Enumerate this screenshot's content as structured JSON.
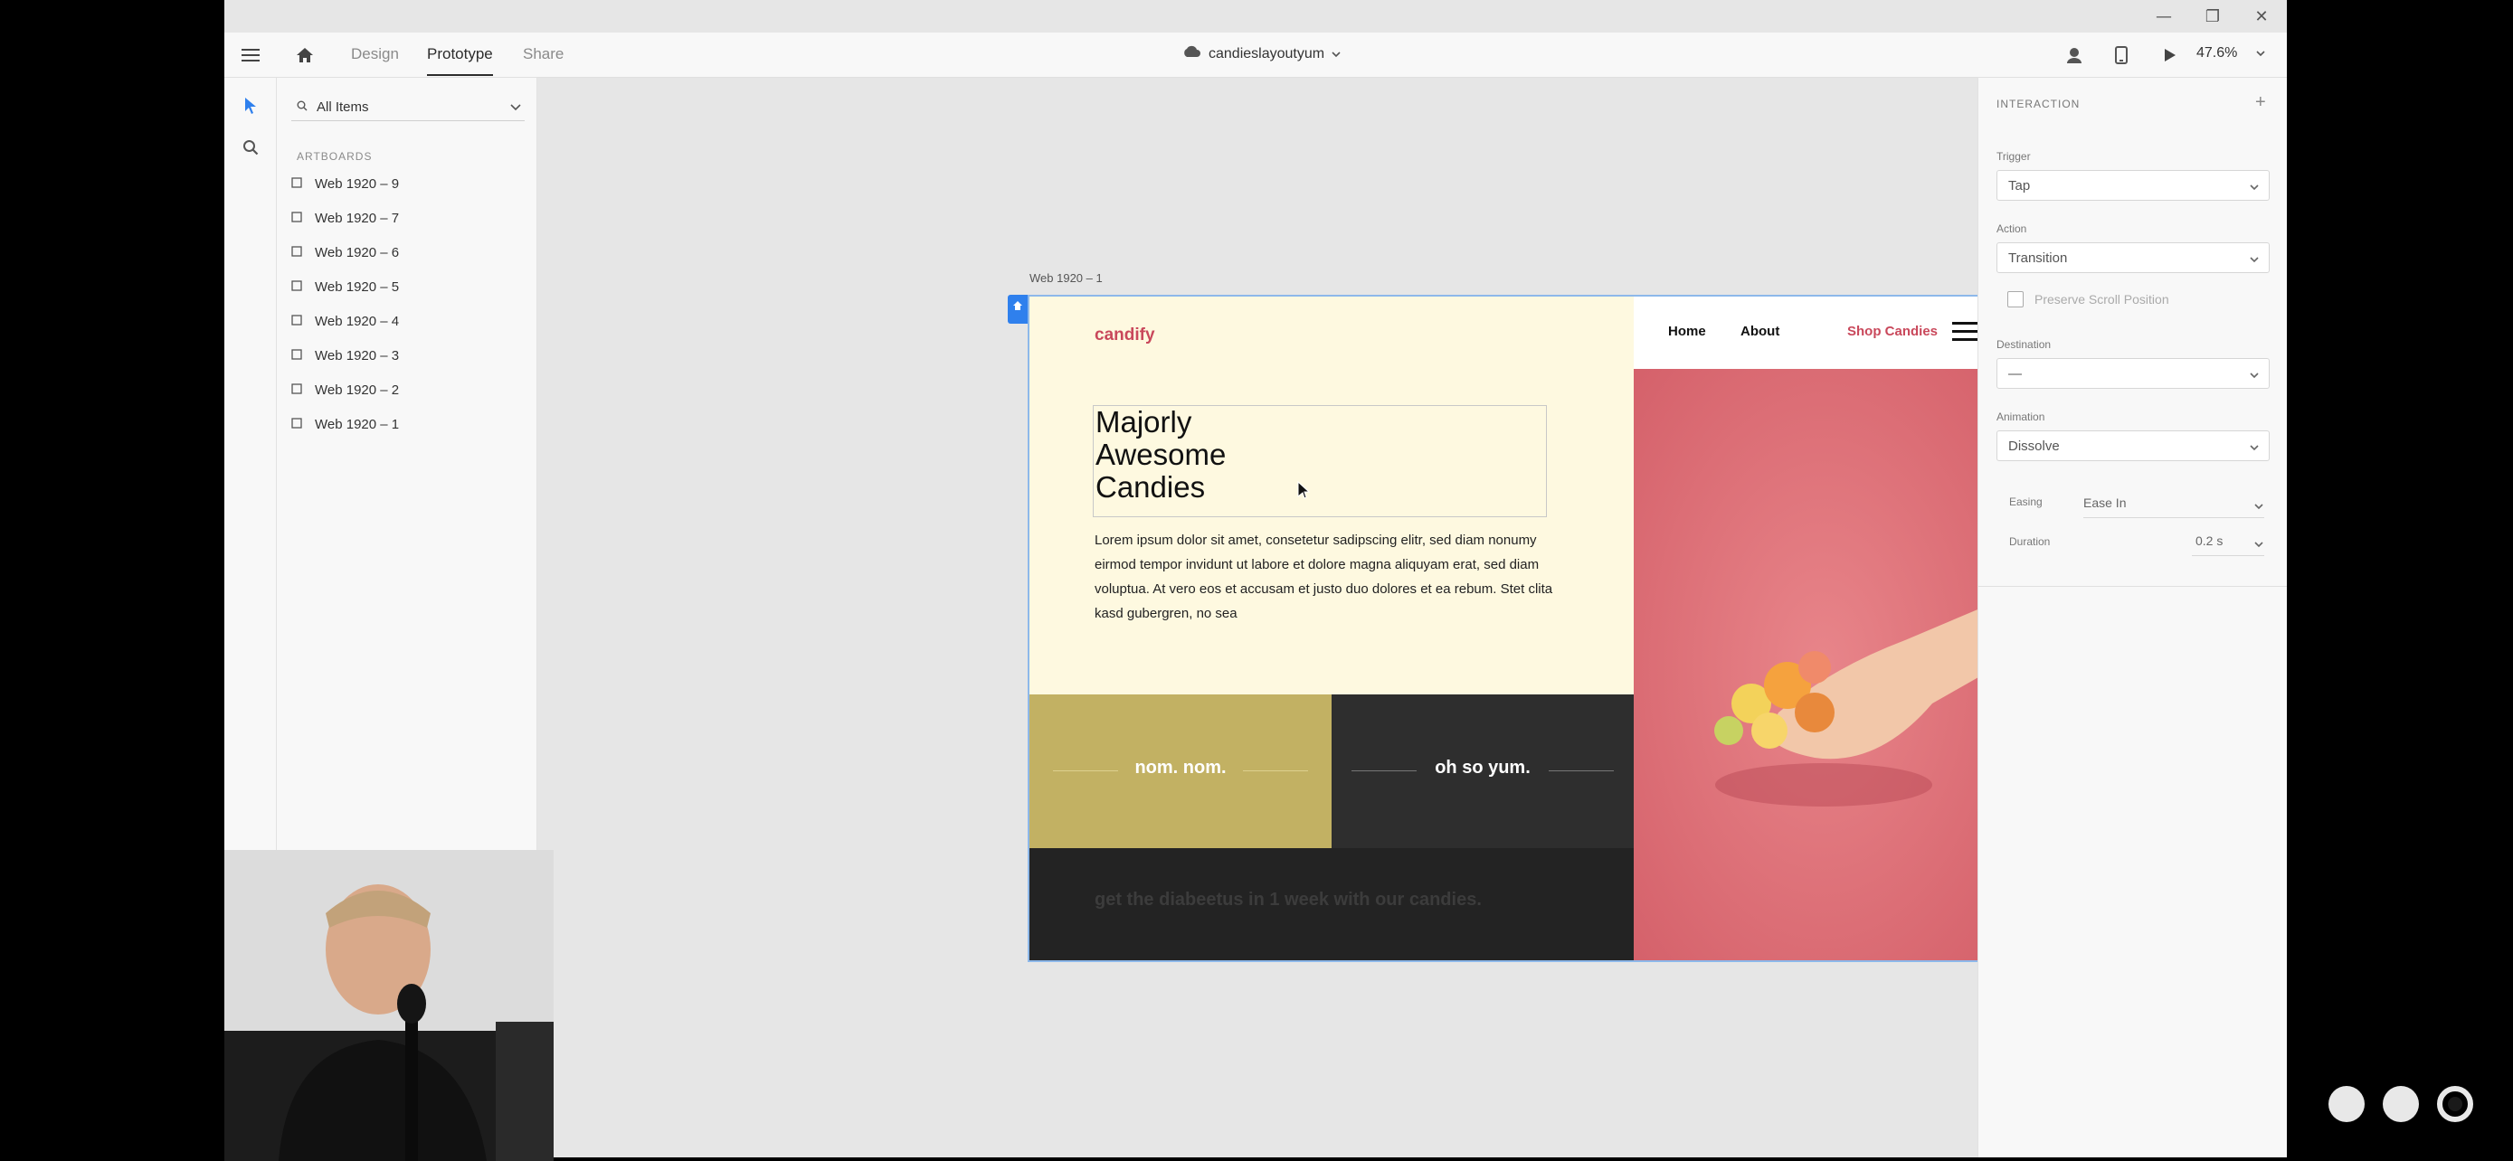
{
  "window": {
    "minimize_glyph": "—",
    "restore_glyph": "❐",
    "close_glyph": "✕"
  },
  "topbar": {
    "tabs": [
      {
        "label": "Design",
        "active": false
      },
      {
        "label": "Prototype",
        "active": true
      },
      {
        "label": "Share",
        "active": false
      }
    ],
    "document_name": "candieslayoutyum",
    "zoom": "47.6%",
    "icons": [
      "menu-icon",
      "home-icon",
      "cloud-icon",
      "user-icon",
      "device-icon",
      "play-icon"
    ]
  },
  "layers": {
    "search_value": "All Items",
    "section_title": "ARTBOARDS",
    "items": [
      {
        "label": "Web 1920 – 9"
      },
      {
        "label": "Web 1920 – 7"
      },
      {
        "label": "Web 1920 – 6"
      },
      {
        "label": "Web 1920 – 5"
      },
      {
        "label": "Web 1920 – 4"
      },
      {
        "label": "Web 1920 – 3"
      },
      {
        "label": "Web 1920 – 2"
      },
      {
        "label": "Web 1920 – 1"
      }
    ]
  },
  "artboard": {
    "label": "Web 1920 – 1",
    "logo": "candify",
    "headline": [
      "Majorly",
      "Awesome",
      "Candies"
    ],
    "body": "Lorem ipsum dolor sit amet, consetetur sadipscing elitr, sed diam nonumy eirmod tempor invidunt ut labore et dolore magna aliquyam erat, sed diam voluptua. At vero eos et accusam et justo duo dolores et ea rebum. Stet clita kasd gubergren, no sea",
    "nav": {
      "home": "Home",
      "about": "About",
      "shop": "Shop Candies"
    },
    "tile_left": "nom. nom.",
    "tile_right": "oh so yum.",
    "footer": "get the diabeetus in 1 week with our candies.",
    "colors": {
      "cream": "#fef9e0",
      "brand": "#c9485b",
      "mustard": "#c2b163",
      "dark": "#2e2e2e",
      "pink": "#e07078"
    }
  },
  "interaction": {
    "title": "INTERACTION",
    "add_glyph": "+",
    "trigger_label": "Trigger",
    "trigger_value": "Tap",
    "action_label": "Action",
    "action_value": "Transition",
    "preserve_label": "Preserve Scroll Position",
    "destination_label": "Destination",
    "destination_value": "—",
    "animation_label": "Animation",
    "animation_value": "Dissolve",
    "easing_label": "Easing",
    "easing_value": "Ease In",
    "duration_label": "Duration",
    "duration_value": "0.2 s"
  }
}
